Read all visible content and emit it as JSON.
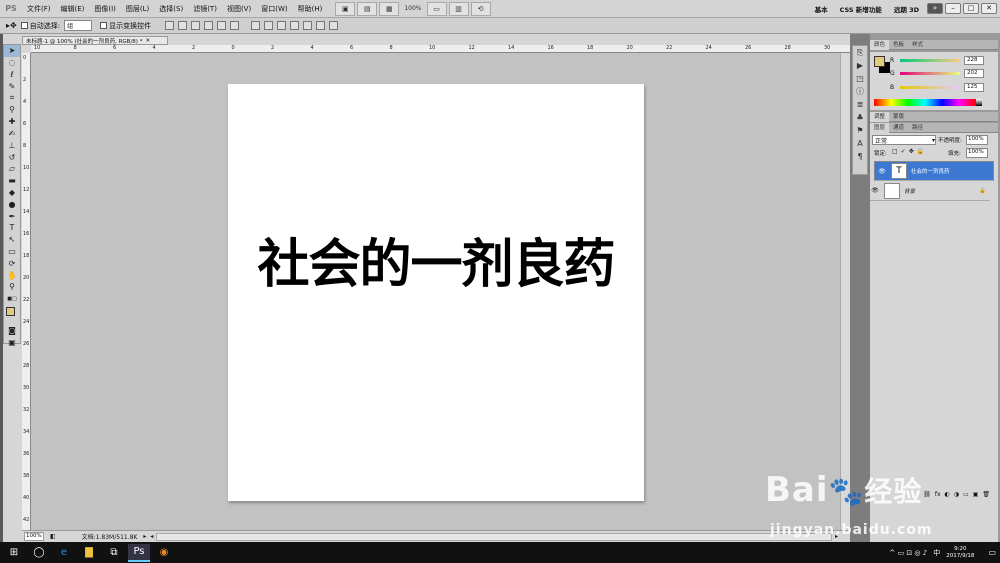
{
  "menubar": {
    "logo": "PS",
    "menus": [
      "文件(F)",
      "编辑(E)",
      "图像(I)",
      "图层(L)",
      "选择(S)",
      "滤镜(T)",
      "视图(V)",
      "窗口(W)",
      "帮助(H)"
    ],
    "zoom": "100%",
    "workspaces": [
      "基本",
      "CSS 新增功能",
      "远期 3D"
    ],
    "window_controls": [
      "–",
      "□",
      "✕"
    ]
  },
  "options": {
    "auto_select_label": "自动选择:",
    "auto_select_value": "组",
    "show_transform_label": "显示变换控件"
  },
  "document": {
    "tab_title": "未标题-1 @ 100% (社会的一剂良药, RGB/8) *",
    "canvas_text": "社会的一剂良药",
    "status_zoom": "100%",
    "status_doc": "文档:1.83M/511.8K",
    "ruler_h": [
      "10",
      "8",
      "6",
      "4",
      "2",
      "0",
      "2",
      "4",
      "6",
      "8",
      "10",
      "12",
      "14",
      "16",
      "18",
      "20",
      "22",
      "24",
      "26",
      "28",
      "30"
    ],
    "ruler_v": [
      "0",
      "2",
      "4",
      "6",
      "8",
      "10",
      "12",
      "14",
      "16",
      "18",
      "20",
      "22",
      "24",
      "26",
      "28",
      "30",
      "32",
      "34",
      "36",
      "38",
      "40",
      "42"
    ]
  },
  "color_panel": {
    "tabs": [
      "颜色",
      "色板",
      "样式"
    ],
    "channels": [
      {
        "label": "R",
        "value": "228"
      },
      {
        "label": "G",
        "value": "202"
      },
      {
        "label": "B",
        "value": "125"
      }
    ],
    "fg_color": "#e4ca7d"
  },
  "adjust_panel": {
    "tabs": [
      "调整",
      "蒙版"
    ]
  },
  "layers_panel": {
    "tabs": [
      "图层",
      "通道",
      "路径"
    ],
    "blend_mode": "正常",
    "opacity_label": "不透明度:",
    "opacity_value": "100%",
    "lock_label": "锁定:",
    "fill_label": "填充:",
    "fill_value": "100%",
    "layers": [
      {
        "name": "社会的一剂良药",
        "thumb": "T",
        "selected": true
      },
      {
        "name": "背景",
        "thumb": "",
        "selected": false
      }
    ]
  },
  "taskbar": {
    "time": "9:20",
    "date": "2017/9/18",
    "ime": "中"
  },
  "watermark": {
    "brand": "Bai",
    "brand2": "经验",
    "url": "jingyan.baidu.com"
  }
}
